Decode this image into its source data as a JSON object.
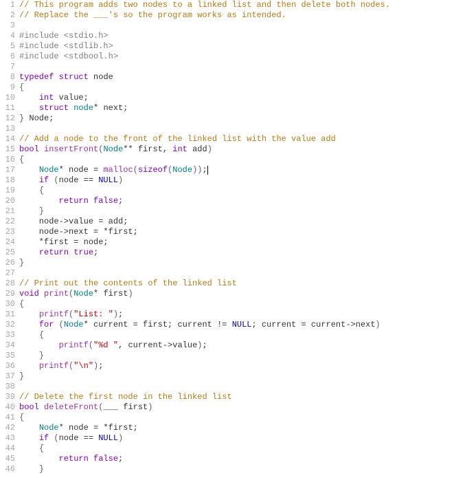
{
  "lines": [
    {
      "n": 1,
      "tokens": [
        [
          "c-comment",
          "// This program adds two nodes to a linked list and then delete both nodes."
        ]
      ]
    },
    {
      "n": 2,
      "tokens": [
        [
          "c-comment",
          "// Replace the ___'s so the program works as intended."
        ]
      ]
    },
    {
      "n": 3,
      "tokens": []
    },
    {
      "n": 4,
      "tokens": [
        [
          "c-preproc",
          "#include <stdio.h>"
        ]
      ]
    },
    {
      "n": 5,
      "tokens": [
        [
          "c-preproc",
          "#include <stdlib.h>"
        ]
      ]
    },
    {
      "n": 6,
      "tokens": [
        [
          "c-preproc",
          "#include <stdbool.h>"
        ]
      ]
    },
    {
      "n": 7,
      "tokens": []
    },
    {
      "n": 8,
      "tokens": [
        [
          "c-keyword",
          "typedef"
        ],
        [
          "c-plain",
          " "
        ],
        [
          "c-keyword",
          "struct"
        ],
        [
          "c-plain",
          " node"
        ]
      ]
    },
    {
      "n": 9,
      "tokens": [
        [
          "c-paren",
          "{"
        ]
      ]
    },
    {
      "n": 10,
      "tokens": [
        [
          "c-plain",
          "    "
        ],
        [
          "c-keyword",
          "int"
        ],
        [
          "c-plain",
          " value;"
        ]
      ]
    },
    {
      "n": 11,
      "tokens": [
        [
          "c-plain",
          "    "
        ],
        [
          "c-keyword",
          "struct"
        ],
        [
          "c-plain",
          " "
        ],
        [
          "c-type",
          "node"
        ],
        [
          "c-plain",
          "* next;"
        ]
      ]
    },
    {
      "n": 12,
      "tokens": [
        [
          "c-paren",
          "}"
        ],
        [
          "c-plain",
          " Node;"
        ]
      ]
    },
    {
      "n": 13,
      "tokens": []
    },
    {
      "n": 14,
      "tokens": [
        [
          "c-comment",
          "// Add a node to the front of the linked list with the value add"
        ]
      ]
    },
    {
      "n": 15,
      "tokens": [
        [
          "c-keyword",
          "bool"
        ],
        [
          "c-plain",
          " "
        ],
        [
          "c-func",
          "insertFront"
        ],
        [
          "c-paren",
          "("
        ],
        [
          "c-type",
          "Node"
        ],
        [
          "c-plain",
          "** first, "
        ],
        [
          "c-keyword",
          "int"
        ],
        [
          "c-plain",
          " add"
        ],
        [
          "c-paren",
          ")"
        ]
      ]
    },
    {
      "n": 16,
      "tokens": [
        [
          "c-paren",
          "{"
        ]
      ]
    },
    {
      "n": 17,
      "tokens": [
        [
          "c-plain",
          "    "
        ],
        [
          "c-type",
          "Node"
        ],
        [
          "c-plain",
          "* node = "
        ],
        [
          "c-func",
          "malloc"
        ],
        [
          "c-paren",
          "("
        ],
        [
          "c-keyword",
          "sizeof"
        ],
        [
          "c-paren",
          "("
        ],
        [
          "c-type",
          "Node"
        ],
        [
          "c-paren",
          "))"
        ],
        [
          "c-plain",
          ";"
        ],
        [
          "cursor",
          ""
        ]
      ]
    },
    {
      "n": 18,
      "tokens": [
        [
          "c-plain",
          "    "
        ],
        [
          "c-keyword",
          "if"
        ],
        [
          "c-plain",
          " "
        ],
        [
          "c-paren",
          "("
        ],
        [
          "c-plain",
          "node == "
        ],
        [
          "c-null",
          "NULL"
        ],
        [
          "c-paren",
          ")"
        ]
      ]
    },
    {
      "n": 19,
      "tokens": [
        [
          "c-plain",
          "    "
        ],
        [
          "c-paren",
          "{"
        ]
      ]
    },
    {
      "n": 20,
      "tokens": [
        [
          "c-plain",
          "        "
        ],
        [
          "c-keyword",
          "return"
        ],
        [
          "c-plain",
          " "
        ],
        [
          "c-keyword",
          "false"
        ],
        [
          "c-plain",
          ";"
        ]
      ]
    },
    {
      "n": 21,
      "tokens": [
        [
          "c-plain",
          "    "
        ],
        [
          "c-paren",
          "}"
        ]
      ]
    },
    {
      "n": 22,
      "tokens": [
        [
          "c-plain",
          "    node->value = add;"
        ]
      ]
    },
    {
      "n": 23,
      "tokens": [
        [
          "c-plain",
          "    node->next = *first;"
        ]
      ]
    },
    {
      "n": 24,
      "tokens": [
        [
          "c-plain",
          "    *first = node;"
        ]
      ]
    },
    {
      "n": 25,
      "tokens": [
        [
          "c-plain",
          "    "
        ],
        [
          "c-keyword",
          "return"
        ],
        [
          "c-plain",
          " "
        ],
        [
          "c-keyword",
          "true"
        ],
        [
          "c-plain",
          ";"
        ]
      ]
    },
    {
      "n": 26,
      "tokens": [
        [
          "c-paren",
          "}"
        ]
      ]
    },
    {
      "n": 27,
      "tokens": []
    },
    {
      "n": 28,
      "tokens": [
        [
          "c-comment",
          "// Print out the contents of the linked list"
        ]
      ]
    },
    {
      "n": 29,
      "tokens": [
        [
          "c-keyword",
          "void"
        ],
        [
          "c-plain",
          " "
        ],
        [
          "c-func",
          "print"
        ],
        [
          "c-paren",
          "("
        ],
        [
          "c-type",
          "Node"
        ],
        [
          "c-plain",
          "* first"
        ],
        [
          "c-paren",
          ")"
        ]
      ]
    },
    {
      "n": 30,
      "tokens": [
        [
          "c-paren",
          "{"
        ]
      ]
    },
    {
      "n": 31,
      "tokens": [
        [
          "c-plain",
          "    "
        ],
        [
          "c-func",
          "printf"
        ],
        [
          "c-paren",
          "("
        ],
        [
          "c-string",
          "\"List: \""
        ],
        [
          "c-paren",
          ")"
        ],
        [
          "c-plain",
          ";"
        ]
      ]
    },
    {
      "n": 32,
      "tokens": [
        [
          "c-plain",
          "    "
        ],
        [
          "c-keyword",
          "for"
        ],
        [
          "c-plain",
          " "
        ],
        [
          "c-paren",
          "("
        ],
        [
          "c-type",
          "Node"
        ],
        [
          "c-plain",
          "* current = first; current != "
        ],
        [
          "c-null",
          "NULL"
        ],
        [
          "c-plain",
          "; current = current->next"
        ],
        [
          "c-paren",
          ")"
        ]
      ]
    },
    {
      "n": 33,
      "tokens": [
        [
          "c-plain",
          "    "
        ],
        [
          "c-paren",
          "{"
        ]
      ]
    },
    {
      "n": 34,
      "tokens": [
        [
          "c-plain",
          "        "
        ],
        [
          "c-func",
          "printf"
        ],
        [
          "c-paren",
          "("
        ],
        [
          "c-string",
          "\"%d \""
        ],
        [
          "c-plain",
          ", current->value"
        ],
        [
          "c-paren",
          ")"
        ],
        [
          "c-plain",
          ";"
        ]
      ]
    },
    {
      "n": 35,
      "tokens": [
        [
          "c-plain",
          "    "
        ],
        [
          "c-paren",
          "}"
        ]
      ]
    },
    {
      "n": 36,
      "tokens": [
        [
          "c-plain",
          "    "
        ],
        [
          "c-func",
          "printf"
        ],
        [
          "c-paren",
          "("
        ],
        [
          "c-string",
          "\"\\n\""
        ],
        [
          "c-paren",
          ")"
        ],
        [
          "c-plain",
          ";"
        ]
      ]
    },
    {
      "n": 37,
      "tokens": [
        [
          "c-paren",
          "}"
        ]
      ]
    },
    {
      "n": 38,
      "tokens": []
    },
    {
      "n": 39,
      "tokens": [
        [
          "c-comment",
          "// Delete the first node in the linked list"
        ]
      ]
    },
    {
      "n": 40,
      "tokens": [
        [
          "c-keyword",
          "bool"
        ],
        [
          "c-plain",
          " "
        ],
        [
          "c-func",
          "deleteFront"
        ],
        [
          "c-paren",
          "("
        ],
        [
          "c-plain",
          "___ first"
        ],
        [
          "c-paren",
          ")"
        ]
      ]
    },
    {
      "n": 41,
      "tokens": [
        [
          "c-paren",
          "{"
        ]
      ]
    },
    {
      "n": 42,
      "tokens": [
        [
          "c-plain",
          "    "
        ],
        [
          "c-type",
          "Node"
        ],
        [
          "c-plain",
          "* node = *first;"
        ]
      ]
    },
    {
      "n": 43,
      "tokens": [
        [
          "c-plain",
          "    "
        ],
        [
          "c-keyword",
          "if"
        ],
        [
          "c-plain",
          " "
        ],
        [
          "c-paren",
          "("
        ],
        [
          "c-plain",
          "node == "
        ],
        [
          "c-null",
          "NULL"
        ],
        [
          "c-paren",
          ")"
        ]
      ]
    },
    {
      "n": 44,
      "tokens": [
        [
          "c-plain",
          "    "
        ],
        [
          "c-paren",
          "{"
        ]
      ]
    },
    {
      "n": 45,
      "tokens": [
        [
          "c-plain",
          "        "
        ],
        [
          "c-keyword",
          "return"
        ],
        [
          "c-plain",
          " "
        ],
        [
          "c-keyword",
          "false"
        ],
        [
          "c-plain",
          ";"
        ]
      ]
    },
    {
      "n": 46,
      "tokens": [
        [
          "c-plain",
          "    "
        ],
        [
          "c-paren",
          "}"
        ]
      ]
    }
  ]
}
